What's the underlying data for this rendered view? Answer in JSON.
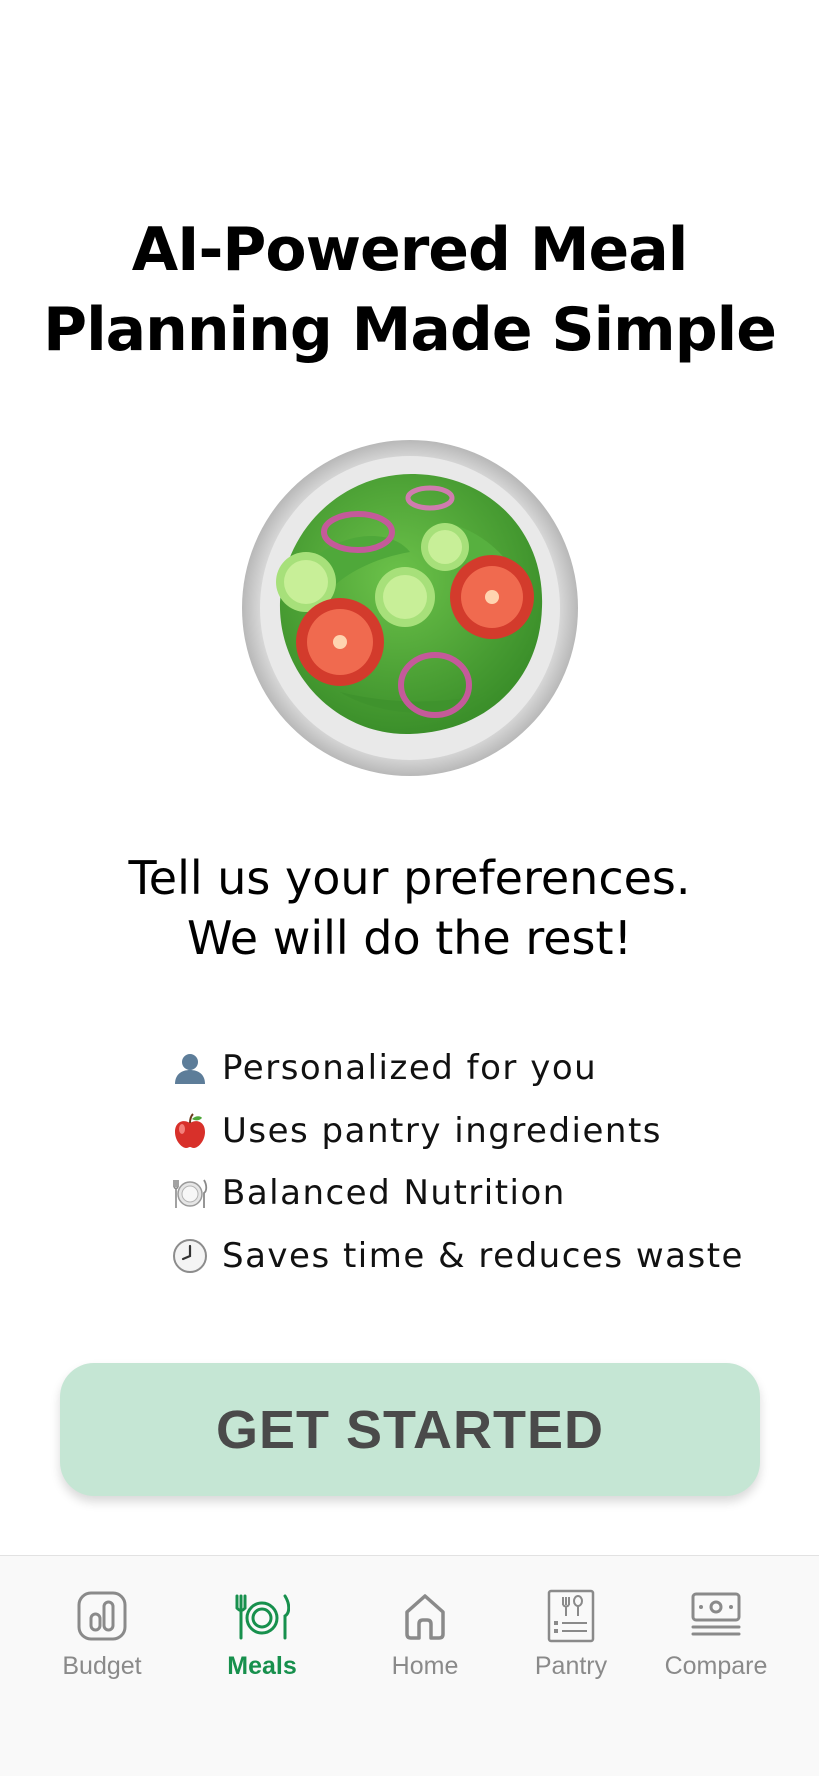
{
  "title": {
    "line1": "AI-Powered Meal",
    "line2": "Planning Made Simple"
  },
  "hero": {
    "icon": "green-salad-emoji"
  },
  "subtitle": {
    "line1": "Tell us your preferences.",
    "line2": "We will do the rest!"
  },
  "features": [
    {
      "icon": "person-icon",
      "text": "Personalized for you"
    },
    {
      "icon": "apple-icon",
      "text": "Uses pantry ingredients"
    },
    {
      "icon": "plate-cutlery-icon",
      "text": "Balanced Nutrition"
    },
    {
      "icon": "clock-icon",
      "text": "Saves time & reduces waste"
    }
  ],
  "cta": {
    "label": "GET STARTED",
    "background": "#c5e6d4",
    "text_color": "#4a4a4a"
  },
  "tabbar": {
    "active_color": "#17904d",
    "inactive_color": "#8a8a8a",
    "tabs": [
      {
        "label": "Budget",
        "icon": "bar-chart-icon",
        "active": false
      },
      {
        "label": "Meals",
        "icon": "plate-cutlery-icon",
        "active": true
      },
      {
        "label": "Home",
        "icon": "home-icon",
        "active": false
      },
      {
        "label": "Pantry",
        "icon": "pantry-list-icon",
        "active": false
      },
      {
        "label": "Compare",
        "icon": "money-stack-icon",
        "active": false
      }
    ]
  }
}
